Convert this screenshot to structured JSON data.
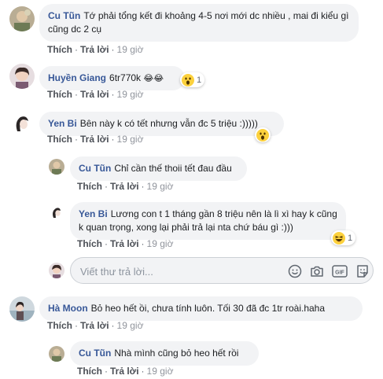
{
  "actions": {
    "like": "Thích",
    "reply": "Trả lời",
    "separator": "·"
  },
  "comments": [
    {
      "name": "Cu Tũn",
      "text": "Tớ phải tổng kết đi khoảng 4-5 nơi mới dc nhiều , mai đi kiểu gì cũng dc 2 cụ",
      "time": "19 giờ"
    },
    {
      "name": "Huyền Giang",
      "text": "6tr770k",
      "emoji": "😂😂",
      "time": "19 giờ",
      "reaction": {
        "icon": "wow-reaction-icon",
        "count": "1"
      }
    },
    {
      "name": "Yen Bi",
      "text": "Bên này k có tết nhưng vẫn đc 5 triệu :)))))",
      "time": "19 giờ",
      "reaction": {
        "icon": "wow-reaction-icon"
      }
    },
    {
      "name": "Cu Tũn",
      "text": "Chỉ cần thế thoii tết đau đầu",
      "time": "19 giờ"
    },
    {
      "name": "Yen Bi",
      "text": "Lương con t 1 tháng gần 8 triệu nên là lì xì hay k cũng k quan trọng, xong lại phải trả lại nta chứ báu gì :)))",
      "time": "19 giờ",
      "reaction": {
        "icon": "haha-reaction-icon",
        "count": "1"
      }
    },
    {
      "name": "Hà Moon",
      "text": "Bỏ heo hết ồi, chưa tính luôn. Tối 30 đã đc 1tr roài.haha",
      "time": "19 giờ"
    },
    {
      "name": "Cu Tũn",
      "text": "Nhà mình cũng bỏ heo hết rồi",
      "time": "19 giờ"
    }
  ],
  "reply_input": {
    "placeholder": "Viết thư trả lời...",
    "value": ""
  },
  "reply_tools": [
    "emoji-icon",
    "camera-icon",
    "gif-icon",
    "sticker-icon"
  ],
  "colors": {
    "name": "#385898",
    "bubble": "#f2f3f5",
    "meta": "#90949c",
    "link": "#4b4f56"
  }
}
